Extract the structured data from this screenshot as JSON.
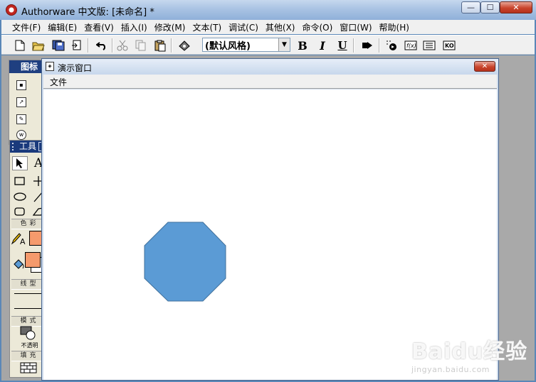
{
  "window": {
    "title": "Authorware 中文版: [未命名] *",
    "controls": {
      "minimize": "—",
      "maximize": "☐",
      "close": "✕"
    }
  },
  "menubar": [
    "文件(F)",
    "编辑(E)",
    "查看(V)",
    "插入(I)",
    "修改(M)",
    "文本(T)",
    "调试(C)",
    "其他(X)",
    "命令(O)",
    "窗口(W)",
    "帮助(H)"
  ],
  "toolbar": {
    "style_select": {
      "value": "(默认风格)"
    },
    "bold": "B",
    "italic": "I",
    "underline": "U",
    "icons": [
      "new-icon",
      "open-icon",
      "save-all-icon",
      "import-icon",
      "undo-icon",
      "cut-icon",
      "copy-icon",
      "paste-icon",
      "find-icon",
      "run-icon",
      "control-panel-icon",
      "functions-icon",
      "variables-icon",
      "knowledge-objects-icon"
    ]
  },
  "icon_palette": {
    "title": "图标"
  },
  "tools_panel": {
    "title": "工具",
    "sections": {
      "color": "色彩",
      "line": "线型",
      "mode": "模式",
      "fill": "填充"
    },
    "mode_value": "不透明",
    "colors": {
      "stroke": "#f59a6c",
      "fill_fg": "#f59a6c",
      "fill_bg": "#ffffff"
    }
  },
  "presentation": {
    "title": "演示窗口",
    "menu": [
      "文件"
    ],
    "shape": {
      "type": "octagon",
      "color": "#5b9bd5"
    }
  },
  "watermark": {
    "main": "Baidu经验",
    "sub": "jingyan.baidu.com"
  }
}
